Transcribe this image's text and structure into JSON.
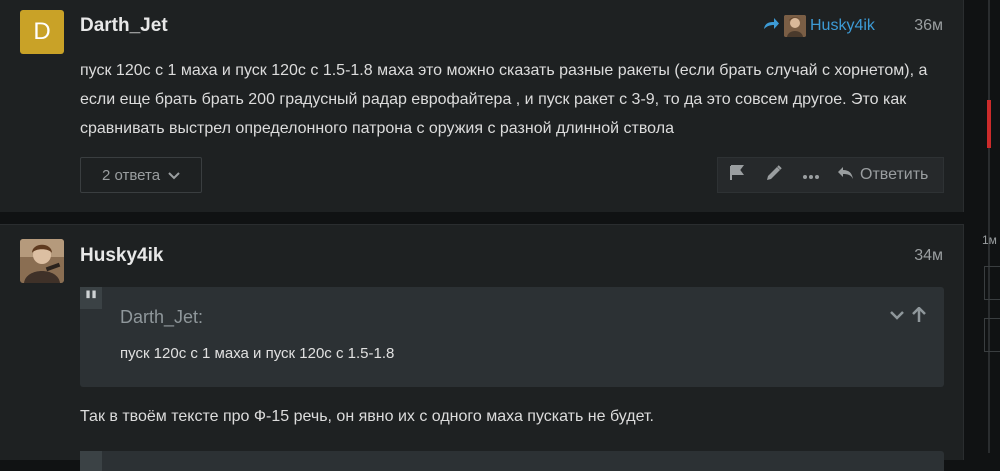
{
  "posts": [
    {
      "avatar_letter": "D",
      "avatar_color": "#c9a227",
      "username": "Darth_Jet",
      "reply_to": "Husky4ik",
      "time": "36м",
      "text": "пуск 120с с 1 маха и пуск 120с с 1.5-1.8 маха это можно сказать разные ракеты (если брать случай с хорнетом), а если еще брать брать 200 градусный радар еврофайтера , и пуск ракет с 3-9, то да это совсем другое. Это как сравнивать выстрел определонного патрона с оружия с разной длинной ствола",
      "replies_label": "2 ответа",
      "reply_button": "Ответить"
    },
    {
      "username": "Husky4ik",
      "time": "34м",
      "quote": {
        "author": "Darth_Jet:",
        "text": "пуск 120с с 1 маха и пуск 120с с 1.5-1.8"
      },
      "text": "Так в твоём тексте про Ф-15 речь, он явно их с одного маха пускать не будет."
    }
  ],
  "timeline": {
    "label": "1м"
  },
  "colors": {
    "accent_link": "#3d9bd6",
    "timeline_thumb": "#cc2b2b"
  }
}
